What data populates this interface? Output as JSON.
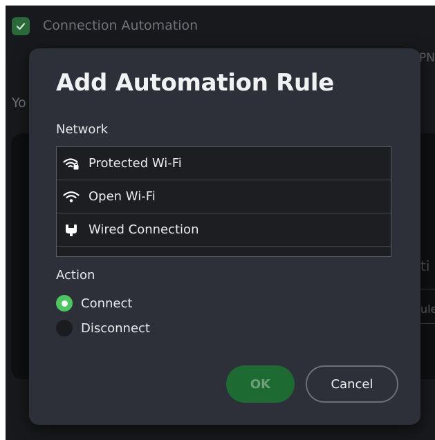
{
  "background": {
    "header_title": "Connection Automation",
    "partial_vpn": "PN",
    "partial_you": "Yo",
    "partial_right_heading": "ti",
    "partial_right_text": "ule"
  },
  "dialog": {
    "title": "Add Automation Rule",
    "network_label": "Network",
    "networks": [
      {
        "label": "Protected Wi-Fi",
        "icon": "wifi-lock-icon"
      },
      {
        "label": "Open Wi-Fi",
        "icon": "wifi-icon"
      },
      {
        "label": "Wired Connection",
        "icon": "ethernet-icon"
      }
    ],
    "action_label": "Action",
    "actions": [
      {
        "label": "Connect",
        "selected": true
      },
      {
        "label": "Disconnect",
        "selected": false
      }
    ],
    "ok_label": "OK",
    "cancel_label": "Cancel"
  },
  "colors": {
    "accent_green": "#4cc65e",
    "ok_button": "#1d6b32",
    "dialog_bg": "#2d3038"
  }
}
